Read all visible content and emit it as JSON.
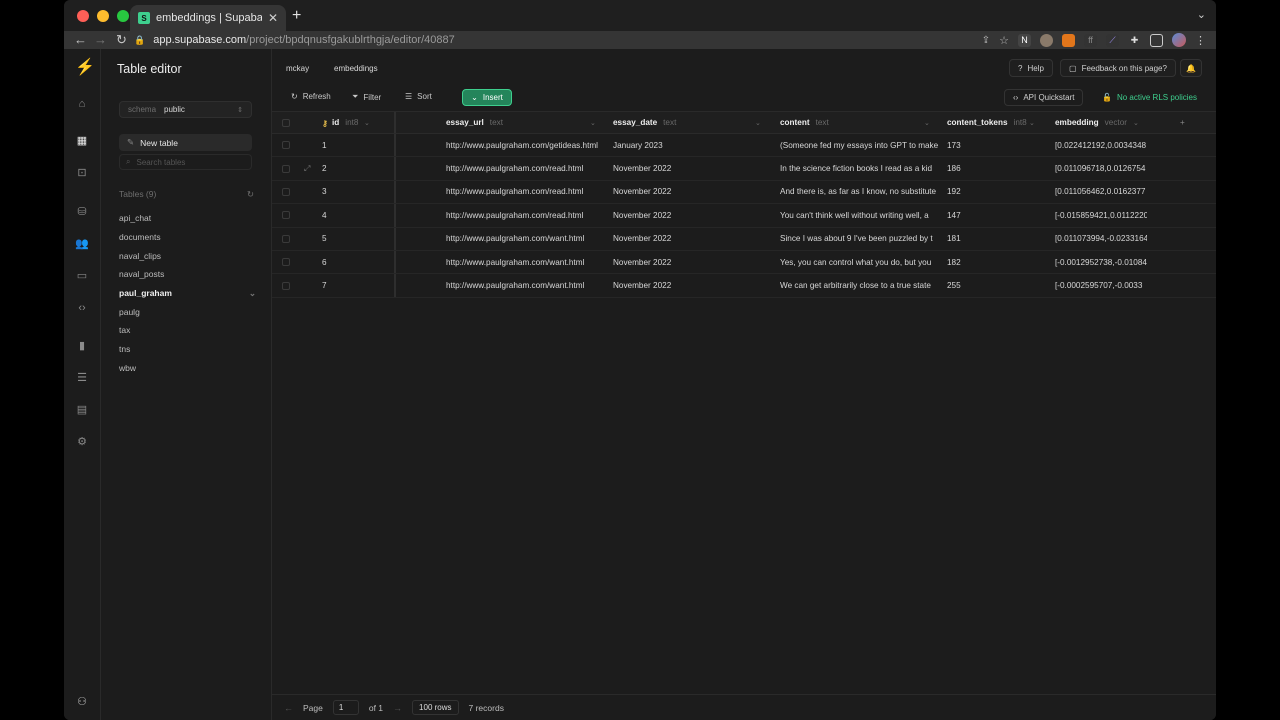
{
  "browser": {
    "tab_title": "embeddings | Supabase",
    "url_host": "app.supabase.com",
    "url_path": "/project/bpdqnusfgakublrthgja/editor/40887",
    "new_tab": "+",
    "close": "✕"
  },
  "colors": {
    "accent": "#3ecf8e",
    "insert_bg": "#24855b",
    "background": "#1c1c1c"
  },
  "sidebar": {
    "title": "Table editor",
    "schema_label": "schema",
    "schema_value": "public",
    "new_table": "New table",
    "search_placeholder": "Search tables",
    "tables_header": "Tables (9)",
    "tables": [
      "api_chat",
      "documents",
      "naval_clips",
      "naval_posts",
      "paul_graham",
      "paulg",
      "tax",
      "tns",
      "wbw"
    ],
    "active_table": "paul_graham"
  },
  "topbar": {
    "crumb_1": "mckay",
    "crumb_2": "embeddings",
    "help": "Help",
    "feedback": "Feedback on this page?"
  },
  "actions": {
    "refresh": "Refresh",
    "filter": "Filter",
    "sort": "Sort",
    "insert": "Insert",
    "api_quickstart": "API Quickstart",
    "rls": "No active RLS policies"
  },
  "grid": {
    "columns": [
      {
        "name": "id",
        "type": "int8"
      },
      {
        "name": "essay_url",
        "type": "text"
      },
      {
        "name": "essay_date",
        "type": "text"
      },
      {
        "name": "content",
        "type": "text"
      },
      {
        "name": "content_tokens",
        "type": "int8"
      },
      {
        "name": "embedding",
        "type": "vector"
      }
    ],
    "rows": [
      [
        "1",
        "http://www.paulgraham.com/getideas.html",
        "January 2023",
        "(Someone fed my essays into GPT to make",
        "173",
        "[0.022412192,0.0034348"
      ],
      [
        "2",
        "http://www.paulgraham.com/read.html",
        "November 2022",
        "In the science fiction books I read as a kid",
        "186",
        "[0.011096718,0.0126754"
      ],
      [
        "3",
        "http://www.paulgraham.com/read.html",
        "November 2022",
        "And there is, as far as I know, no substitute",
        "192",
        "[0.011056462,0.0162377"
      ],
      [
        "4",
        "http://www.paulgraham.com/read.html",
        "November 2022",
        "You can't think well without writing well, a",
        "147",
        "[-0.015859421,0.0112220"
      ],
      [
        "5",
        "http://www.paulgraham.com/want.html",
        "November 2022",
        "Since I was about 9 I've been puzzled by t",
        "181",
        "[0.011073994,-0.0233164"
      ],
      [
        "6",
        "http://www.paulgraham.com/want.html",
        "November 2022",
        "Yes, you can control what you do, but you",
        "182",
        "[-0.0012952738,-0.01084"
      ],
      [
        "7",
        "http://www.paulgraham.com/want.html",
        "November 2022",
        "We can get arbitrarily close to a true state",
        "255",
        "[-0.0002595707,-0.0033"
      ]
    ]
  },
  "footer": {
    "page_label": "Page",
    "page_value": "1",
    "of": "of 1",
    "rows": "100 rows",
    "records": "7 records"
  }
}
